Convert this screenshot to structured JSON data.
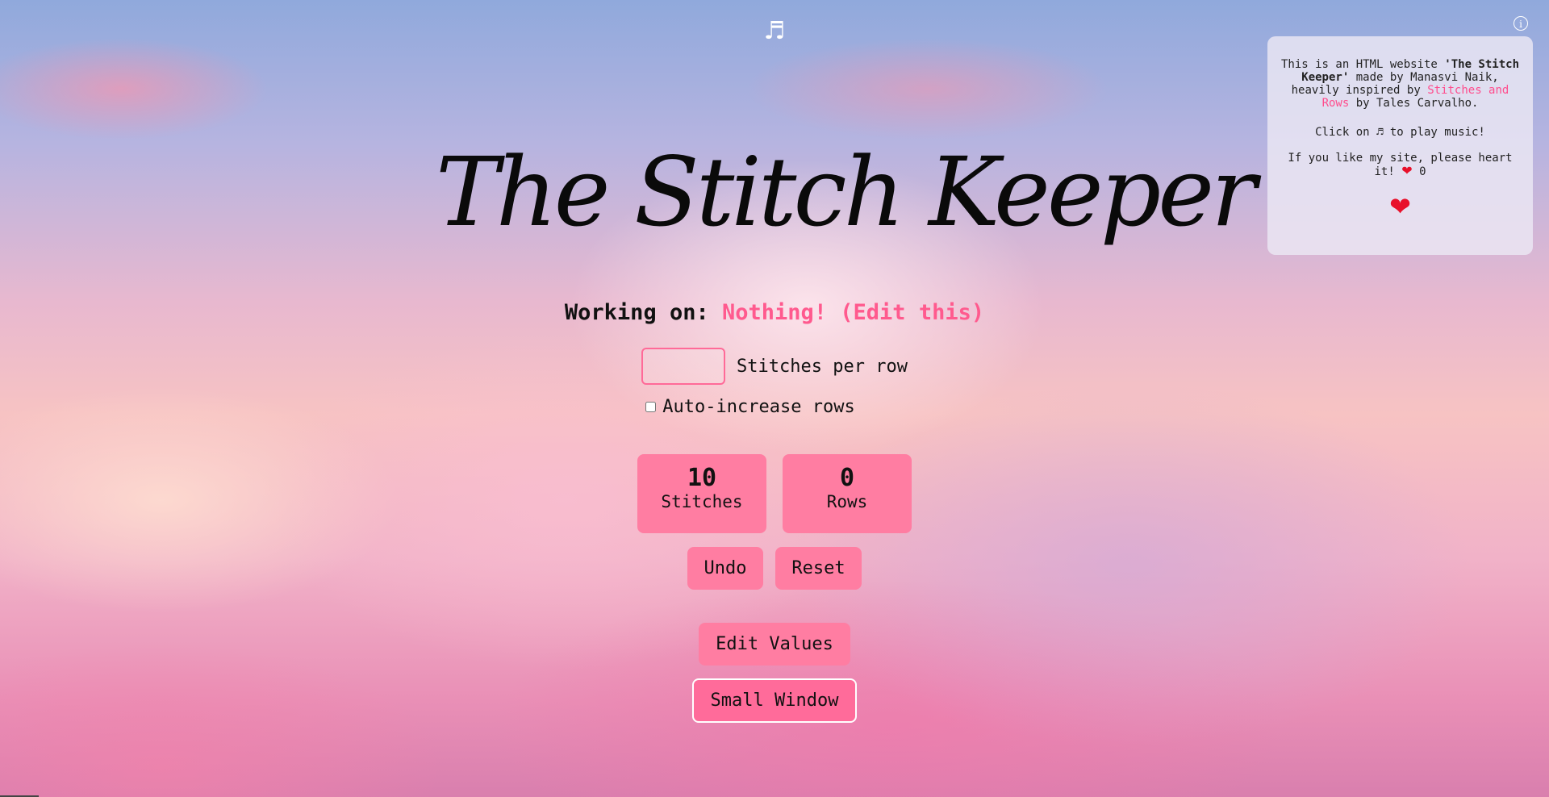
{
  "header": {
    "music_icon": "♬",
    "info_icon": "i"
  },
  "info_panel": {
    "line1_prefix": "This is an HTML website ",
    "site_name": "'The Stitch Keeper'",
    "line1_suffix": " made by Manasvi Naik, heavily inspired by ",
    "link_text": "Stitches and Rows",
    "line1_end": " by Tales Carvalho.",
    "music_prefix": "Click on ",
    "music_glyph": "♬",
    "music_suffix": " to play music!",
    "heart_prefix": "If you like my site, please heart it! ",
    "heart_glyph": "❤",
    "heart_count": "0",
    "big_heart": "❤"
  },
  "title": "The Stitch Keeper",
  "working_on": {
    "label": "Working on:",
    "project": "Nothing! (Edit this)"
  },
  "stitches_per_row": {
    "value": "",
    "placeholder": "",
    "label": "Stitches per row"
  },
  "auto_increase": {
    "label": "Auto-increase rows",
    "checked": false
  },
  "counters": {
    "stitches": {
      "value": "10",
      "label": "Stitches"
    },
    "rows": {
      "value": "0",
      "label": "Rows"
    }
  },
  "buttons": {
    "undo": "Undo",
    "reset": "Reset",
    "edit_values": "Edit Values",
    "small_window": "Small Window"
  },
  "colors": {
    "accent": "#ff7da2",
    "link": "#ff4d8d",
    "project_text": "#ff5a8e",
    "heart": "#e8102a"
  }
}
